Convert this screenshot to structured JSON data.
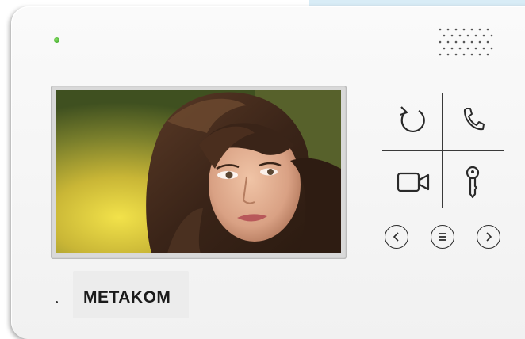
{
  "device": {
    "brand": "METAKOM",
    "led_color": "#3fb02a",
    "frame_color": "#f4f4f4",
    "icon_color": "#2a2a2a"
  },
  "screen": {
    "content": "portrait-photo"
  },
  "controls": {
    "icons": [
      "redo-arrow-icon",
      "phone-handset-icon",
      "video-camera-icon",
      "key-icon",
      "chevron-left-icon",
      "menu-icon",
      "chevron-right-icon"
    ]
  }
}
